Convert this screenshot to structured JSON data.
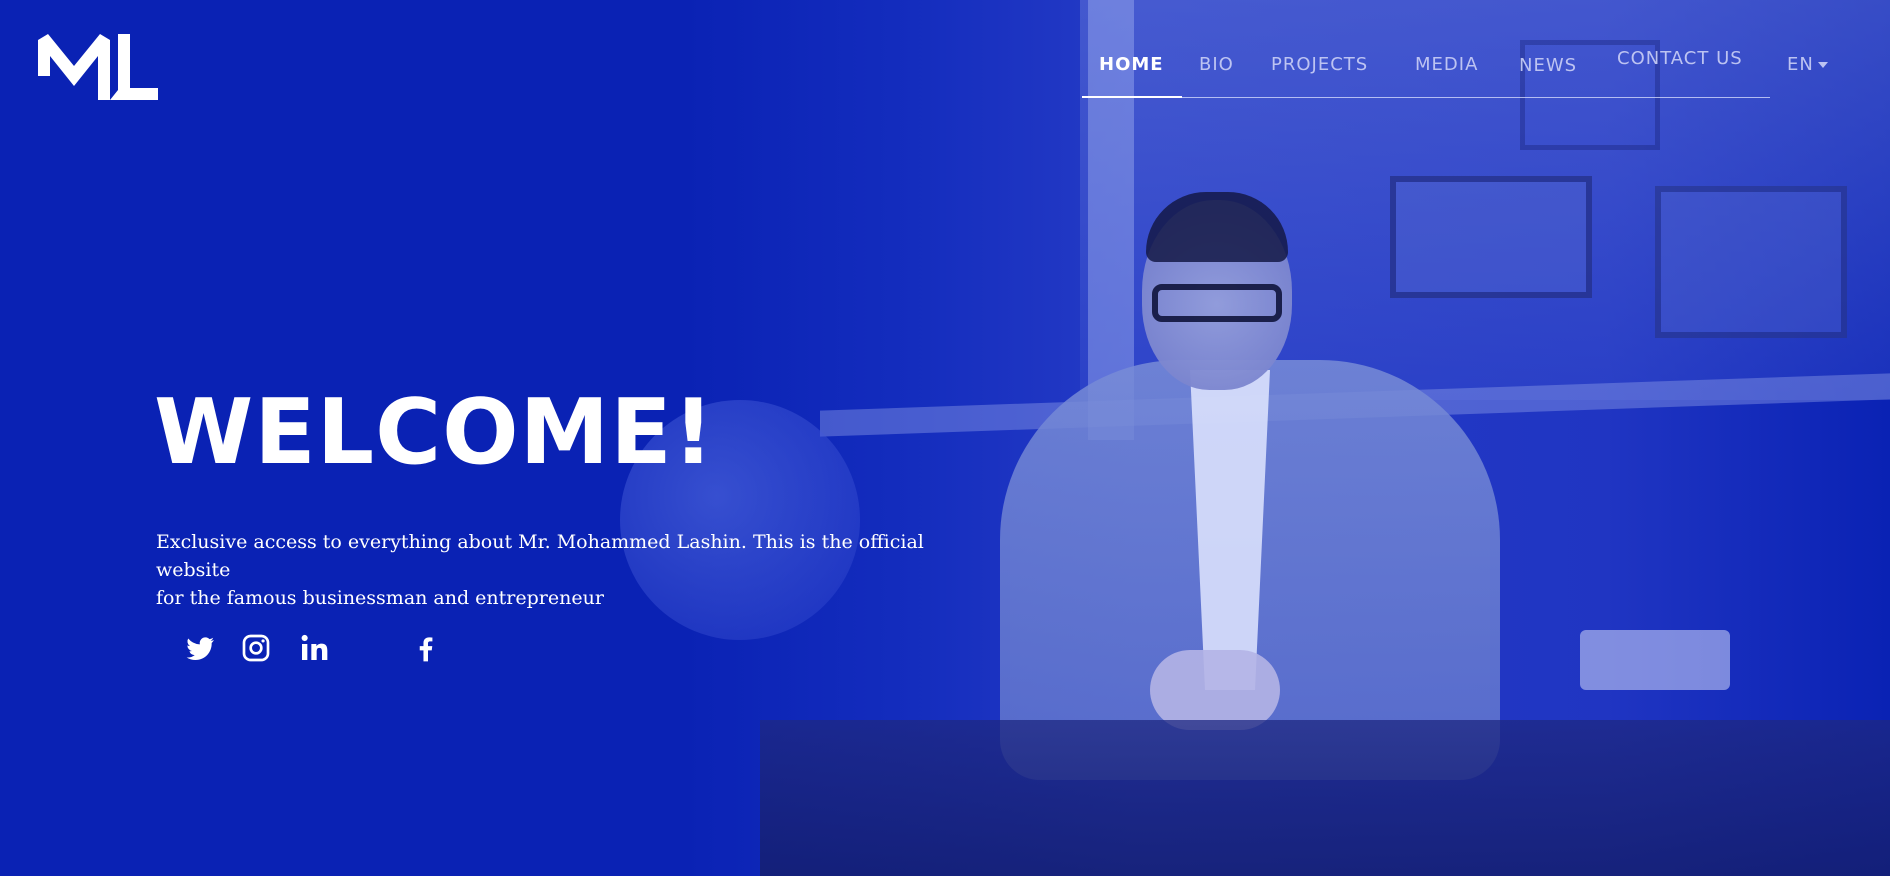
{
  "brand": {
    "logo_icon": "ml-monogram-logo"
  },
  "nav": {
    "items": [
      {
        "label": "HOME",
        "active": true
      },
      {
        "label": "BIO",
        "active": false
      },
      {
        "label": "PROJECTS",
        "active": false
      },
      {
        "label": "MEDIA",
        "active": false
      },
      {
        "label": "NEWS",
        "active": false
      },
      {
        "label": "CONTACT US",
        "active": false
      }
    ],
    "language": "EN"
  },
  "hero": {
    "title": "WELCOME!",
    "subtitle_line1": "Exclusive access to everything about Mr. Mohammed Lashin. This is the official website",
    "subtitle_line2": "for the famous businessman and entrepreneur"
  },
  "social": {
    "icons": [
      "twitter-icon",
      "instagram-icon",
      "linkedin-icon",
      "facebook-icon"
    ]
  },
  "colors": {
    "background": "#0a22b4",
    "text": "#ffffff",
    "nav_inactive": "#c8cdf5"
  }
}
